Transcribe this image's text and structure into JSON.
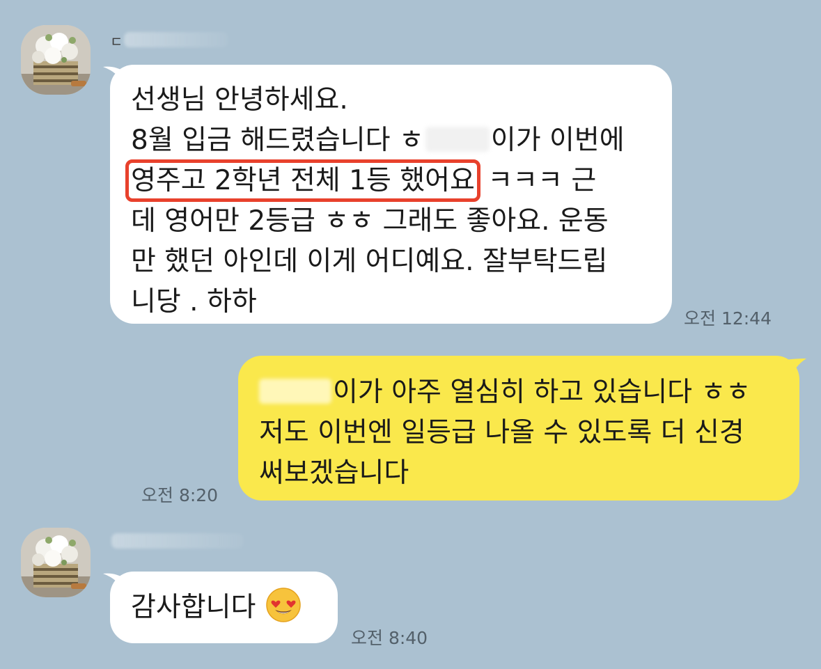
{
  "messages": [
    {
      "side": "received",
      "lines": [
        "선생님 안녕하세요.",
        "8월 입금 해드렸습니다 ㅎ",
        "이가 이번에",
        "영주고 2학년  전체 1등 했어요",
        "ㅋㅋㅋ 근",
        "데 영어만 2등급 ㅎㅎ 그래도 좋아요. 운동",
        "만 했던 아인데 이게 어디예요. 잘부탁드립",
        "니당 . 하하"
      ],
      "time": "오전 12:44"
    },
    {
      "side": "sent",
      "lines": [
        "이가 아주 열심히 하고 있습니다 ㅎㅎ",
        "저도 이번엔 일등급 나올 수 있도록 더 신경",
        "써보겠습니다"
      ],
      "time": "오전 8:20"
    },
    {
      "side": "received",
      "lines": [
        "감사합니다"
      ],
      "emoji": "heart-eyes-emoji",
      "time": "오전 8:40"
    }
  ],
  "colors": {
    "background": "#abc1d1",
    "received_bubble": "#ffffff",
    "sent_bubble": "#fae84c",
    "highlight_box": "#e8412c",
    "timestamp": "#53606a"
  }
}
